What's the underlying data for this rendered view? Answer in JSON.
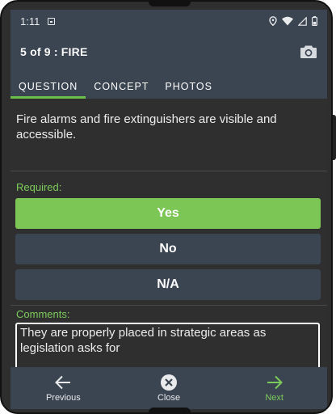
{
  "status_bar": {
    "time": "1:11"
  },
  "app_bar": {
    "title": "5 of 9 : FIRE"
  },
  "tabs": [
    {
      "label": "QUESTION",
      "active": true
    },
    {
      "label": "CONCEPT",
      "active": false
    },
    {
      "label": "PHOTOS",
      "active": false
    }
  ],
  "question": {
    "text": "Fire alarms and fire extinguishers are visible and accessible."
  },
  "answer_section": {
    "label": "Required:",
    "options": [
      {
        "label": "Yes",
        "selected": true
      },
      {
        "label": "No",
        "selected": false
      },
      {
        "label": "N/A",
        "selected": false
      }
    ]
  },
  "comments": {
    "label": "Comments:",
    "value": "They are properly placed in strategic areas as legislation asks for"
  },
  "bottom_nav": {
    "previous": "Previous",
    "close": "Close",
    "next": "Next"
  },
  "colors": {
    "accent": "#7cc656",
    "bar": "#3b4451",
    "background": "#2f2f2f"
  },
  "icons": {
    "camera": "camera-icon",
    "previous": "arrow-left-icon",
    "close": "close-circle-icon",
    "next": "arrow-right-icon"
  }
}
